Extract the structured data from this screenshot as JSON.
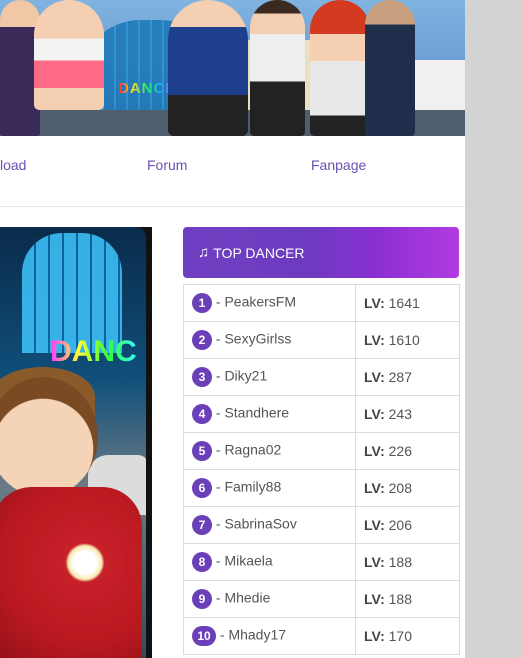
{
  "banner": {
    "sign_text": "DANCE"
  },
  "nav": {
    "items": [
      {
        "label": "load"
      },
      {
        "label": "Forum"
      },
      {
        "label": "Fanpage"
      }
    ]
  },
  "side_image": {
    "sign_text": "DANC"
  },
  "top_dancer": {
    "title": "TOP DANCER",
    "title_icon": "music-note-icon",
    "level_label": "LV:",
    "rows": [
      {
        "rank": "1",
        "name": "- PeakersFM",
        "level": "1641"
      },
      {
        "rank": "2",
        "name": "- SexyGirlss",
        "level": "1610"
      },
      {
        "rank": "3",
        "name": "- Diky21",
        "level": "287"
      },
      {
        "rank": "4",
        "name": "- Standhere",
        "level": "243"
      },
      {
        "rank": "5",
        "name": "- Ragna02",
        "level": "226"
      },
      {
        "rank": "6",
        "name": "- Family88",
        "level": "208"
      },
      {
        "rank": "7",
        "name": "- SabrinaSov",
        "level": "206"
      },
      {
        "rank": "8",
        "name": "- Mikaela",
        "level": "188"
      },
      {
        "rank": "9",
        "name": "- Mhedie",
        "level": "188"
      },
      {
        "rank": "10",
        "name": "- Mhady17",
        "level": "170"
      }
    ]
  },
  "colors": {
    "accent": "#6a3fb8",
    "nav_link": "#6a4fb3",
    "scroll_gutter": "#d3d3d3"
  }
}
